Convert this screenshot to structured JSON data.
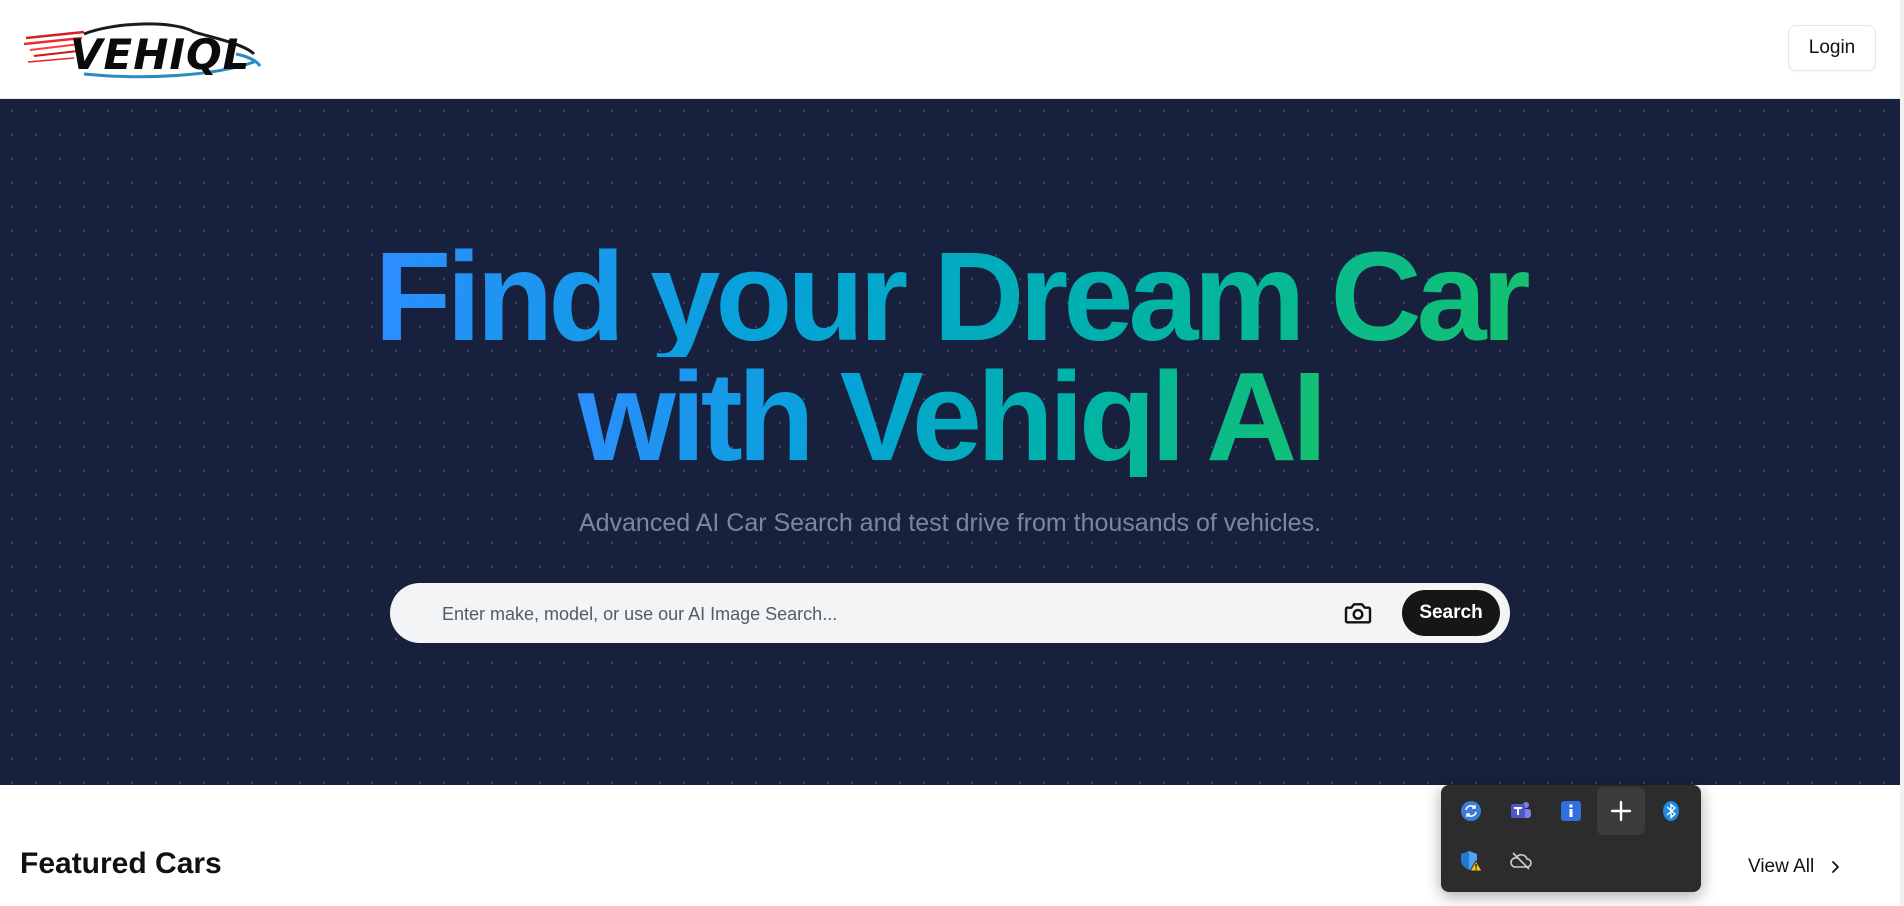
{
  "header": {
    "logo_text": "VEHIQL",
    "login_label": "Login"
  },
  "hero": {
    "title_line1": "Find your Dream Car",
    "title_line2": "with Vehiql AI",
    "subtitle": "Advanced AI Car Search and test drive from thousands of vehicles.",
    "search": {
      "placeholder": "Enter make, model, or use our AI Image Search...",
      "value": "",
      "camera_icon": "camera-icon",
      "button_label": "Search"
    }
  },
  "featured": {
    "title": "Featured Cars",
    "view_all_label": "View All"
  },
  "system_tray": {
    "icons": [
      "sync-icon",
      "teams-icon",
      "info-icon",
      "add-icon",
      "bluetooth-icon",
      "security-warning-icon",
      "cloud-offline-icon"
    ]
  },
  "colors": {
    "hero_bg": "#17213d",
    "gradient_start": "#2e8cff",
    "gradient_end": "#14c26d",
    "search_button_bg": "#161616"
  }
}
